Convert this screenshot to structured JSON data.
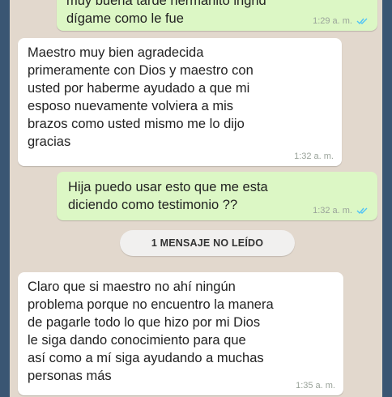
{
  "messages": [
    {
      "direction": "outgoing",
      "text": "muy buena tarde hermanito ingrid\ndígame como le fue",
      "time": "1:29 a. m.",
      "status": "read"
    },
    {
      "direction": "incoming",
      "text": "Maestro muy bien agradecida\nprimeramente con Dios y maestro con\nusted por haberme ayudado a que mi\nesposo nuevamente volviera a mis\nbrazos como usted mismo me lo dijo\ngracias",
      "time": "1:32 a. m."
    },
    {
      "direction": "outgoing",
      "text": "Hija puedo usar esto que me esta\ndiciendo como testimonio ??",
      "time": "1:32 a. m.",
      "status": "read"
    },
    {
      "direction": "incoming",
      "text": "Claro que si maestro no ahí ningún\nproblema porque no encuentro la manera\nde pagarle todo lo que hizo por mi Dios\nle siga dando conocimiento para que\nasí como a mí siga ayudando a muchas\npersonas más",
      "time": "1:35 a. m."
    }
  ],
  "unread_divider": "1 MENSAJE NO LEÍDO",
  "colors": {
    "chat_background": "#e2d8cd",
    "outgoing_bubble": "#dcf7c5",
    "incoming_bubble": "#ffffff",
    "read_ticks": "#4fc3f7"
  },
  "icons": {
    "read_receipt": "double-check-icon"
  }
}
